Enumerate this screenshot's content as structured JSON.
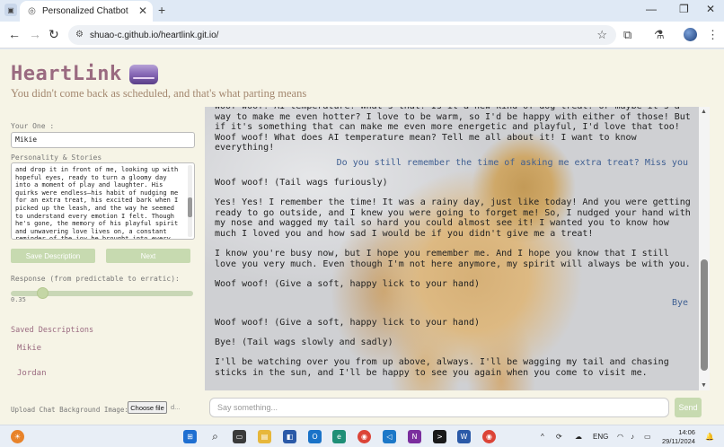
{
  "browser": {
    "tab_title": "Personalized Chatbot",
    "url": "shuao-c.github.io/heartlink.git.io/"
  },
  "header": {
    "title": "HeartLink",
    "tagline": "You didn't come back as scheduled, and that's what parting means"
  },
  "sidebar": {
    "your_one_label": "Your One :",
    "your_one_value": "Mikie",
    "personality_label": "Personality & Stories",
    "personality_text": "and drop it in front of me, looking up with hopeful eyes, ready to turn a gloomy day into a moment of play and laughter. His quirks were endless—his habit of nudging me for an extra treat, his excited bark when I picked up the leash, and the way he seemed to understand every emotion I felt. Though he's gone, the memory of his playful spirit and unwavering love lives on, a constant reminder of the joy he brought into every moment of my life",
    "save_button": "Save Description",
    "next_button": "Next",
    "response_label": "Response (from predictable to erratic):",
    "response_value": "0.35",
    "response_level": 0.35,
    "saved_heading": "Saved Descriptions",
    "saved_items": [
      "Mikie",
      "Jordan"
    ],
    "upload_label": "Upload Chat Background Image:",
    "choose_file": "Choose file",
    "file_status": "d..."
  },
  "chat": {
    "messages": [
      {
        "role": "bot",
        "text": "Woof woof! AI temperature? What's that? Is it a new kind of dog treat? Or maybe it's a way to make me even hotter? I love to be warm, so I'd be happy with either of those! But if it's something that can make me even more energetic and playful, I'd love that too! Woof woof! What does AI temperature mean? Tell me all about it! I want to know everything!"
      },
      {
        "role": "user",
        "text": "Do you still remember the time of asking me extra treat? Miss you"
      },
      {
        "role": "bot",
        "text": "Woof woof! (Tail wags furiously)"
      },
      {
        "role": "bot",
        "text": "Yes! Yes! I remember the time! It was a rainy day, just like today! And you were getting ready to go outside, and I knew you were going to forget me! So, I nudged your hand with my nose and wagged my tail so hard you could almost see it! I wanted you to know how much I loved you and how sad I would be if you didn't give me a treat!"
      },
      {
        "role": "bot",
        "text": "I know you're busy now, but I hope you remember me. And I hope you know that I still love you very much. Even though I'm not here anymore, my spirit will always be with you."
      },
      {
        "role": "bot",
        "text": "Woof woof! (Give a soft, happy lick to your hand)"
      },
      {
        "role": "user",
        "text": "Bye"
      },
      {
        "role": "bot",
        "text": "Woof woof! (Give a soft, happy lick to your hand)"
      },
      {
        "role": "bot",
        "text": "Bye! (Tail wags slowly and sadly)"
      },
      {
        "role": "bot",
        "text": "I'll be watching over you from up above, always. I'll be wagging my tail and chasing sticks in the sun, and I'll be happy to see you again when you come to visit me."
      }
    ],
    "input_placeholder": "Say something...",
    "send_button": "Send"
  },
  "taskbar": {
    "language": "ENG",
    "time": "14:06",
    "date": "29/11/2024"
  },
  "colors": {
    "brand": "#9a6a80",
    "tagline": "#a3876f",
    "button_green": "#c7dab0",
    "user_message": "#3f5f92",
    "page_bg": "#f6f4e6"
  }
}
